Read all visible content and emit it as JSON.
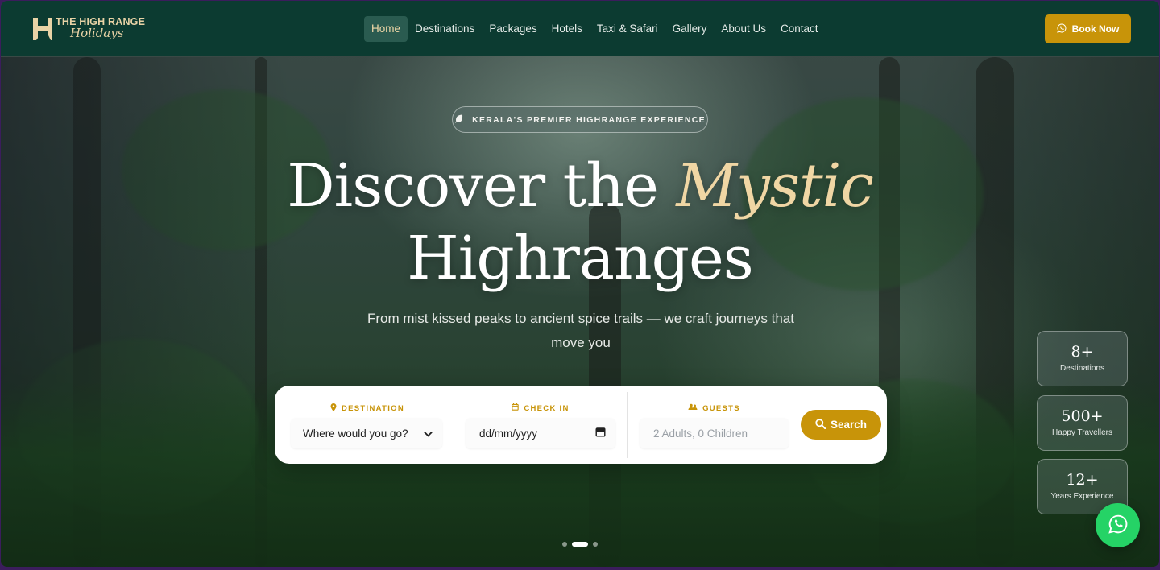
{
  "brand": {
    "name_top": "THE HIGH RANGE",
    "name_script": "Holidays",
    "logo_icon": "mountain-h-logo"
  },
  "nav": {
    "items": [
      {
        "label": "Home",
        "active": true
      },
      {
        "label": "Destinations",
        "active": false
      },
      {
        "label": "Packages",
        "active": false
      },
      {
        "label": "Hotels",
        "active": false
      },
      {
        "label": "Taxi & Safari",
        "active": false
      },
      {
        "label": "Gallery",
        "active": false
      },
      {
        "label": "About Us",
        "active": false
      },
      {
        "label": "Contact",
        "active": false
      }
    ],
    "book_label": "Book Now",
    "book_icon": "whatsapp-icon"
  },
  "hero": {
    "badge": "KERALA'S PREMIER HIGHRANGE EXPERIENCE",
    "badge_icon": "leaf-icon",
    "title_part1": "Discover the ",
    "title_accent": "Mystic",
    "title_part2": "Highranges",
    "subtitle": "From mist kissed peaks to ancient spice trails — we craft journeys that move you"
  },
  "search": {
    "destination": {
      "label": "DESTINATION",
      "icon": "map-pin-icon",
      "value": "Where would you go?"
    },
    "checkin": {
      "label": "CHECK IN",
      "icon": "calendar-icon",
      "value": "dd/mm/yyyy"
    },
    "guests": {
      "label": "GUESTS",
      "icon": "users-icon",
      "placeholder": "2 Adults, 0 Children"
    },
    "button_label": "Search",
    "button_icon": "search-icon"
  },
  "stats": [
    {
      "value": "8+",
      "label": "Destinations"
    },
    {
      "value": "500+",
      "label": "Happy Travellers"
    },
    {
      "value": "12+",
      "label": "Years Experience"
    }
  ],
  "slider": {
    "count": 3,
    "active": 1
  },
  "colors": {
    "nav_bg": "#0c3b31",
    "accent_gold": "#c89409",
    "accent_cream": "#f0d6a4",
    "whatsapp_green": "#25d366"
  }
}
